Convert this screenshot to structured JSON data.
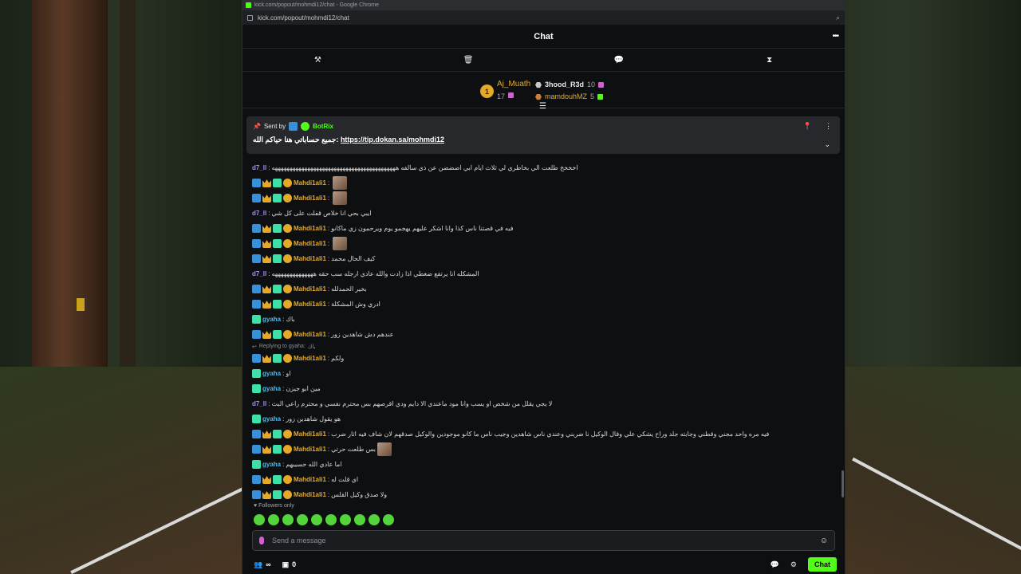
{
  "browser": {
    "window_title": "kick.com/popout/mohmdi12/chat - Google Chrome",
    "url": "kick.com/popout/mohmdi12/chat"
  },
  "chat": {
    "title": "Chat",
    "more_icon": "ellipsis-icon"
  },
  "toolbar": {
    "tools": [
      "hammer-icon",
      "trash-icon",
      "speech-bubble-icon",
      "hourglass-icon"
    ]
  },
  "leaderboard": {
    "first": {
      "rank": "1",
      "name": "Aj_Muath",
      "count": "17"
    },
    "second": {
      "name": "3hood_R3d",
      "count": "10"
    },
    "third": {
      "name": "mamdouhMZ",
      "count": "5"
    }
  },
  "pinned": {
    "sent_by": "Sent by",
    "bot_name": "BotRix",
    "message_prefix": "جميع حساباتي هنا حياكم الله:",
    "link": "https://tip.dokan.sa/mohmdi12"
  },
  "messages": [
    {
      "user": "d7_ll",
      "color": "purple",
      "badges": [],
      "text": "اخخخخ طلعت الي بخاطري لي ثلاث ايام ابي اضضضن عن ذي سالفه ههههههههههههههههههههههههههههههههههههههههههه"
    },
    {
      "user": "Mahdi1ali1",
      "color": "gold",
      "badges": [
        "mod",
        "vip",
        "og",
        "sub"
      ],
      "text": "",
      "emote": true
    },
    {
      "user": "Mahdi1ali1",
      "color": "gold",
      "badges": [
        "mod",
        "vip",
        "og",
        "sub"
      ],
      "text": "",
      "emote": true
    },
    {
      "user": "d7_ll",
      "color": "purple",
      "badges": [],
      "text": "ايبي بحي انا خلاص قفلت على كل شي"
    },
    {
      "user": "Mahdi1ali1",
      "color": "gold",
      "badges": [
        "mod",
        "vip",
        "og",
        "sub"
      ],
      "text": "فيه في قصتنا ناس كذا وانا اشكر عليهم يهجمو يوم ويرحمون زي ماكانو"
    },
    {
      "user": "Mahdi1ali1",
      "color": "gold",
      "badges": [
        "mod",
        "vip",
        "og",
        "sub"
      ],
      "text": "",
      "emote": true
    },
    {
      "user": "Mahdi1ali1",
      "color": "gold",
      "badges": [
        "mod",
        "vip",
        "og",
        "sub"
      ],
      "text": "كيف الحال محمد"
    },
    {
      "user": "d7_ll",
      "color": "purple",
      "badges": [],
      "text": "المشكله انا يرتفع ضغطي اذا زادت والله عادي ارجله سب حقه ههههههههههههههه"
    },
    {
      "user": "Mahdi1ali1",
      "color": "gold",
      "badges": [
        "mod",
        "vip",
        "og",
        "sub"
      ],
      "text": "بخير الحمدلله"
    },
    {
      "user": "Mahdi1ali1",
      "color": "gold",
      "badges": [
        "mod",
        "vip",
        "og",
        "sub"
      ],
      "text": "ادري وش المشكلة"
    },
    {
      "user": "gyaha",
      "color": "cyan",
      "badges": [
        "og"
      ],
      "text": "باك"
    },
    {
      "user": "Mahdi1ali1",
      "color": "gold",
      "badges": [
        "mod",
        "vip",
        "og",
        "sub"
      ],
      "text": "عندهم دش شاهدين زور"
    },
    {
      "reply_to": "Replying to gyaha:",
      "reply_text": "باك",
      "user": "Mahdi1ali1",
      "color": "gold",
      "badges": [
        "mod",
        "vip",
        "og",
        "sub"
      ],
      "text": "ولكم"
    },
    {
      "user": "gyaha",
      "color": "cyan",
      "badges": [
        "og"
      ],
      "text": "او"
    },
    {
      "user": "gyaha",
      "color": "cyan",
      "badges": [
        "og"
      ],
      "text": "مين ابو جيزن"
    },
    {
      "user": "d7_ll",
      "color": "purple",
      "badges": [],
      "text": "لا يجي يقلل من شخص او يسب وانا مود ماعندي الا دايم ودي اقرصهم بس محترم نفسي و محترم راعي البث"
    },
    {
      "user": "gyaha",
      "color": "cyan",
      "badges": [
        "og"
      ],
      "text": "هو يقول شاهدين زور"
    },
    {
      "user": "Mahdi1ali1",
      "color": "gold",
      "badges": [
        "mod",
        "vip",
        "og",
        "sub"
      ],
      "text": "فيه مره واحد مجني وقطني وجابته جلد وراح يشكي علي وقال الوكيل نا ضربني وعندي ناس شاهدين وجيب ناس ما كانو موجودين والوكيل صدقهم لان شاف فيه اثار ضرب"
    },
    {
      "user": "Mahdi1ali1",
      "color": "gold",
      "badges": [
        "mod",
        "vip",
        "og",
        "sub"
      ],
      "text": "بس طلعت حرتي",
      "emote": true
    },
    {
      "user": "gyaha",
      "color": "cyan",
      "badges": [
        "og"
      ],
      "text": "اما عادي الله حسيبهم"
    },
    {
      "user": "Mahdi1ali1",
      "color": "gold",
      "badges": [
        "mod",
        "vip",
        "og",
        "sub"
      ],
      "text": "اي قلت له"
    },
    {
      "user": "Mahdi1ali1",
      "color": "gold",
      "badges": [
        "mod",
        "vip",
        "og",
        "sub"
      ],
      "text": "ولا صدق وكيل القلس"
    }
  ],
  "followers_only": "Followers only",
  "composer": {
    "placeholder": "Send a message"
  },
  "footer": {
    "viewers": "∞",
    "store_count": "0",
    "chat_button": "Chat"
  },
  "colors": {
    "accent": "#53fc18",
    "gold": "#e5a92a",
    "purple": "#a78bfa",
    "cyan": "#4fb8e6"
  }
}
